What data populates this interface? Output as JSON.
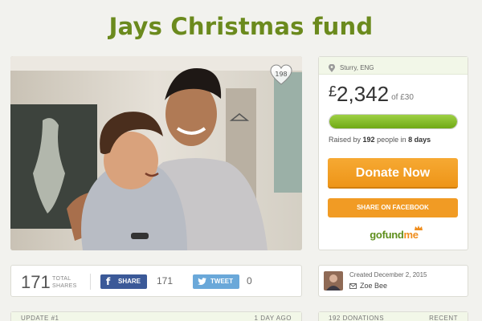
{
  "campaign": {
    "title": "Jays Christmas fund",
    "heart_count": "198"
  },
  "sidebar": {
    "location": "Sturry, ENG",
    "currency": "£",
    "amount": "2,342",
    "goal_prefix": "of",
    "goal": "£30",
    "progress": 1.0,
    "raised_prefix": "Raised by",
    "raised_people": "192",
    "raised_mid": "people in",
    "raised_days": "8 days",
    "donate_label": "Donate Now",
    "share_facebook_label": "SHARE ON FACEBOOK",
    "logo_go": "gofund",
    "logo_me": "me"
  },
  "sharebar": {
    "total": "171",
    "total_label_1": "TOTAL",
    "total_label_2": "SHARES",
    "fb_label": "SHARE",
    "fb_count": "171",
    "tw_label": "TWEET",
    "tw_count": "0"
  },
  "creator": {
    "created": "Created December 2, 2015",
    "name": "Zoe Bee"
  },
  "bottom": {
    "update_header": "UPDATE #1",
    "update_ago": "1 DAY AGO",
    "donations_header": "192 DONATIONS",
    "donations_sort": "RECENT"
  },
  "colors": {
    "title": "#6b8a1d",
    "donate": "#f19b24",
    "progress": "#8cc63f",
    "facebook": "#3b5998",
    "twitter": "#6aa8d9"
  },
  "icons": [
    "heart-icon",
    "location-pin-icon",
    "facebook-icon",
    "twitter-bird-icon",
    "mail-icon",
    "crown-icon"
  ]
}
